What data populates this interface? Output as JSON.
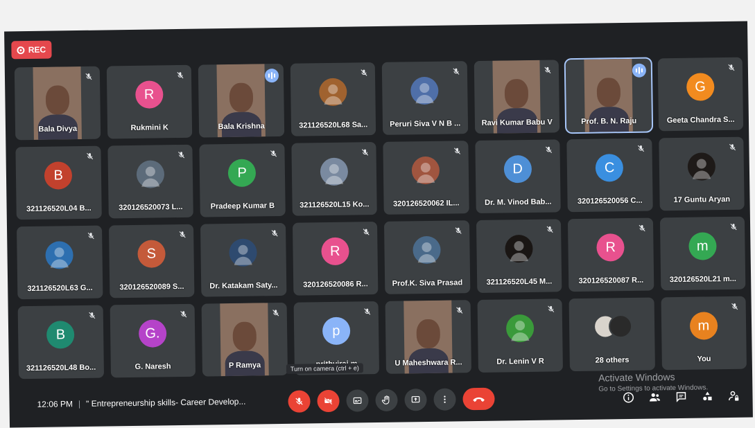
{
  "recording": {
    "label": "REC",
    "color": "#e5484d"
  },
  "tooltip": "Turn on camera (ctrl + e)",
  "meeting": {
    "time": "12:06 PM",
    "separator": "|",
    "title": "\" Entrepreneurship skills- Career Develop..."
  },
  "watermark": {
    "line1": "Activate Windows",
    "line2": "Go to Settings to activate Windows."
  },
  "controls": [
    {
      "name": "mic-off-button",
      "icon": "mic-off-icon",
      "kind": "red"
    },
    {
      "name": "camera-off-button",
      "icon": "camera-off-icon",
      "kind": "red"
    },
    {
      "name": "captions-button",
      "icon": "captions-icon",
      "kind": "gray"
    },
    {
      "name": "raise-hand-button",
      "icon": "hand-icon",
      "kind": "gray"
    },
    {
      "name": "present-button",
      "icon": "present-icon",
      "kind": "gray"
    },
    {
      "name": "more-options-button",
      "icon": "more-vert-icon",
      "kind": "gray"
    },
    {
      "name": "leave-call-button",
      "icon": "hangup-icon",
      "kind": "hang"
    }
  ],
  "right_icons": [
    {
      "name": "meeting-details-button",
      "icon": "info-icon"
    },
    {
      "name": "people-button",
      "icon": "people-icon"
    },
    {
      "name": "chat-button",
      "icon": "chat-icon"
    },
    {
      "name": "activities-button",
      "icon": "activities-icon"
    },
    {
      "name": "host-controls-button",
      "icon": "lock-person-icon"
    }
  ],
  "participants": [
    {
      "name": "Bala Divya",
      "type": "video",
      "indicator": "muted"
    },
    {
      "name": "Rukmini K",
      "type": "avatar",
      "initial": "R",
      "color": "#e8518e",
      "indicator": "muted"
    },
    {
      "name": "Bala Krishna",
      "type": "video",
      "indicator": "speaking"
    },
    {
      "name": "321126520L68 Sa...",
      "type": "photo",
      "color": "#a0622f",
      "indicator": "muted"
    },
    {
      "name": "Peruri Siva V N B ...",
      "type": "photo",
      "color": "#4f6fa8",
      "indicator": "muted"
    },
    {
      "name": "Ravi Kumar Babu V",
      "type": "video",
      "indicator": "muted"
    },
    {
      "name": "Prof. B. N. Raju",
      "type": "video",
      "indicator": "speaking",
      "active": true
    },
    {
      "name": "Geeta Chandra S...",
      "type": "avatar",
      "initial": "G",
      "color": "#f28b1f",
      "indicator": "muted"
    },
    {
      "name": "321126520L04 B...",
      "type": "avatar",
      "initial": "B",
      "color": "#c2412d",
      "indicator": "muted"
    },
    {
      "name": "320126520073 L...",
      "type": "photo",
      "color": "#5c6b7a",
      "indicator": "muted"
    },
    {
      "name": "Pradeep Kumar B",
      "type": "avatar",
      "initial": "P",
      "color": "#34a853",
      "indicator": "muted"
    },
    {
      "name": "321126520L15 Ko...",
      "type": "photo",
      "color": "#7a8aa0",
      "indicator": "muted"
    },
    {
      "name": "320126520062 IL...",
      "type": "photo",
      "color": "#a0553f",
      "indicator": "muted"
    },
    {
      "name": "Dr. M. Vinod Bab...",
      "type": "avatar",
      "initial": "D",
      "color": "#4e8fd6",
      "indicator": "muted"
    },
    {
      "name": "320126520056 C...",
      "type": "avatar",
      "initial": "C",
      "color": "#3a8fe0",
      "indicator": "muted"
    },
    {
      "name": "17 Guntu Aryan",
      "type": "photo",
      "color": "#1e1a18",
      "indicator": "muted"
    },
    {
      "name": "321126520L63 G...",
      "type": "photo",
      "color": "#2d6fb0",
      "indicator": "muted"
    },
    {
      "name": "320126520089 S...",
      "type": "avatar",
      "initial": "S",
      "color": "#c45a3a",
      "indicator": "muted"
    },
    {
      "name": "Dr. Katakam Saty...",
      "type": "photo",
      "color": "#2e4a6f",
      "indicator": "muted"
    },
    {
      "name": "320126520086 R...",
      "type": "avatar",
      "initial": "R",
      "color": "#e8518e",
      "indicator": "muted"
    },
    {
      "name": "Prof.K. Siva Prasad",
      "type": "photo",
      "color": "#4a6a8a",
      "indicator": "muted"
    },
    {
      "name": "321126520L45 M...",
      "type": "photo",
      "color": "#1a1614",
      "indicator": "muted"
    },
    {
      "name": "320126520087 R...",
      "type": "avatar",
      "initial": "R",
      "color": "#e8518e",
      "indicator": "muted"
    },
    {
      "name": "320126520L21 m...",
      "type": "avatar",
      "initial": "m",
      "color": "#34a853",
      "indicator": "muted"
    },
    {
      "name": "321126520L48 Bo...",
      "type": "avatar",
      "initial": "B",
      "color": "#1f8a70",
      "indicator": "muted"
    },
    {
      "name": "G. Naresh",
      "type": "avatar",
      "initial": "G.",
      "color": "#b543c9",
      "indicator": "muted"
    },
    {
      "name": "P Ramya",
      "type": "video",
      "indicator": "muted"
    },
    {
      "name": "prithviraj m",
      "type": "avatar",
      "initial": "p",
      "color": "#8ab4f8",
      "indicator": "muted"
    },
    {
      "name": "U Maheshwara R...",
      "type": "video",
      "indicator": "muted"
    },
    {
      "name": "Dr. Lenin V R",
      "type": "photo",
      "color": "#3a9a3a",
      "indicator": "muted"
    },
    {
      "name": "28 others",
      "type": "others",
      "indicator": "none"
    },
    {
      "name": "You",
      "type": "avatar",
      "initial": "m",
      "color": "#e8821f",
      "indicator": "muted"
    }
  ]
}
